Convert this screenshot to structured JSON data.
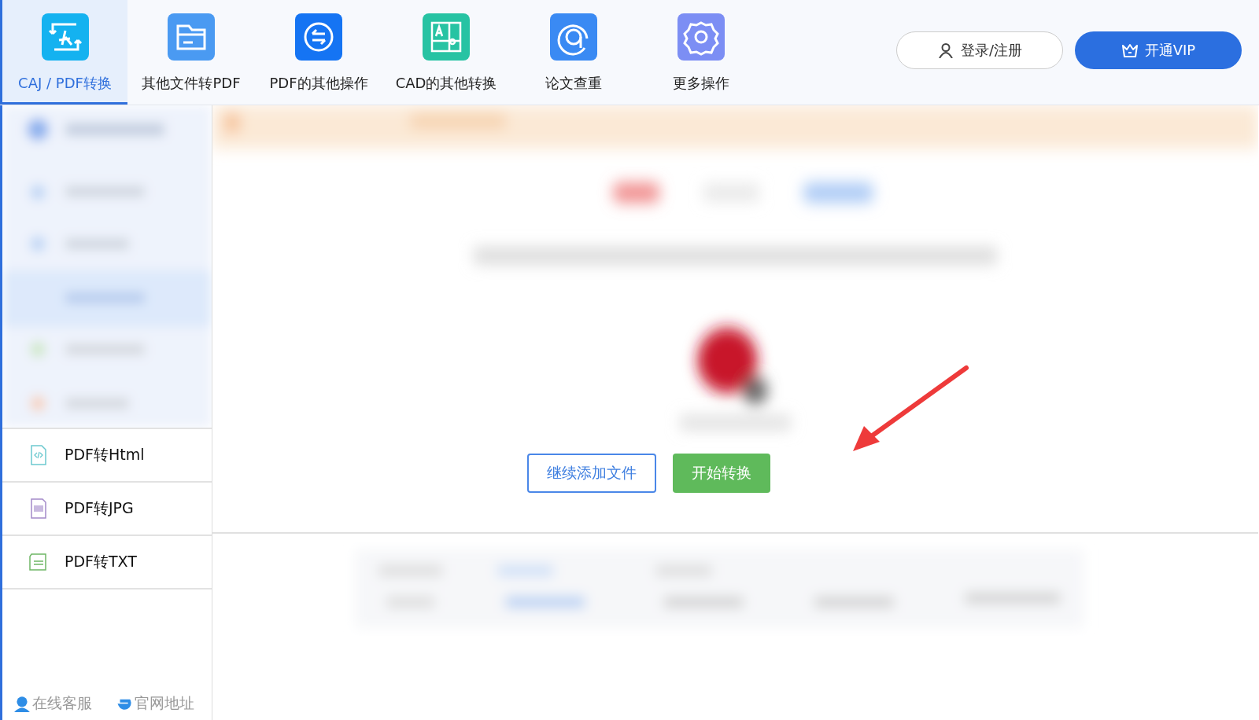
{
  "tabs": [
    {
      "label": "CAJ / PDF转换",
      "kind": "convert",
      "selected": true
    },
    {
      "label": "其他文件转PDF",
      "kind": "folder",
      "selected": false
    },
    {
      "label": "PDF的其他操作",
      "kind": "swap",
      "selected": false
    },
    {
      "label": "CAD的其他转换",
      "kind": "cad",
      "selected": false
    },
    {
      "label": "论文查重",
      "kind": "check",
      "selected": false
    },
    {
      "label": "更多操作",
      "kind": "gear",
      "selected": false
    }
  ],
  "account": {
    "login": "登录/注册",
    "vip": "开通VIP"
  },
  "sidebar": {
    "items": [
      {
        "label": "PDF转Html",
        "kind": "html"
      },
      {
        "label": "PDF转JPG",
        "kind": "jpg"
      },
      {
        "label": "PDF转TXT",
        "kind": "txt"
      }
    ],
    "footer": [
      {
        "label": "在线客服",
        "kind": "service"
      },
      {
        "label": "官网地址",
        "kind": "web"
      }
    ]
  },
  "actions": {
    "add": "继续添加文件",
    "start": "开始转换"
  }
}
